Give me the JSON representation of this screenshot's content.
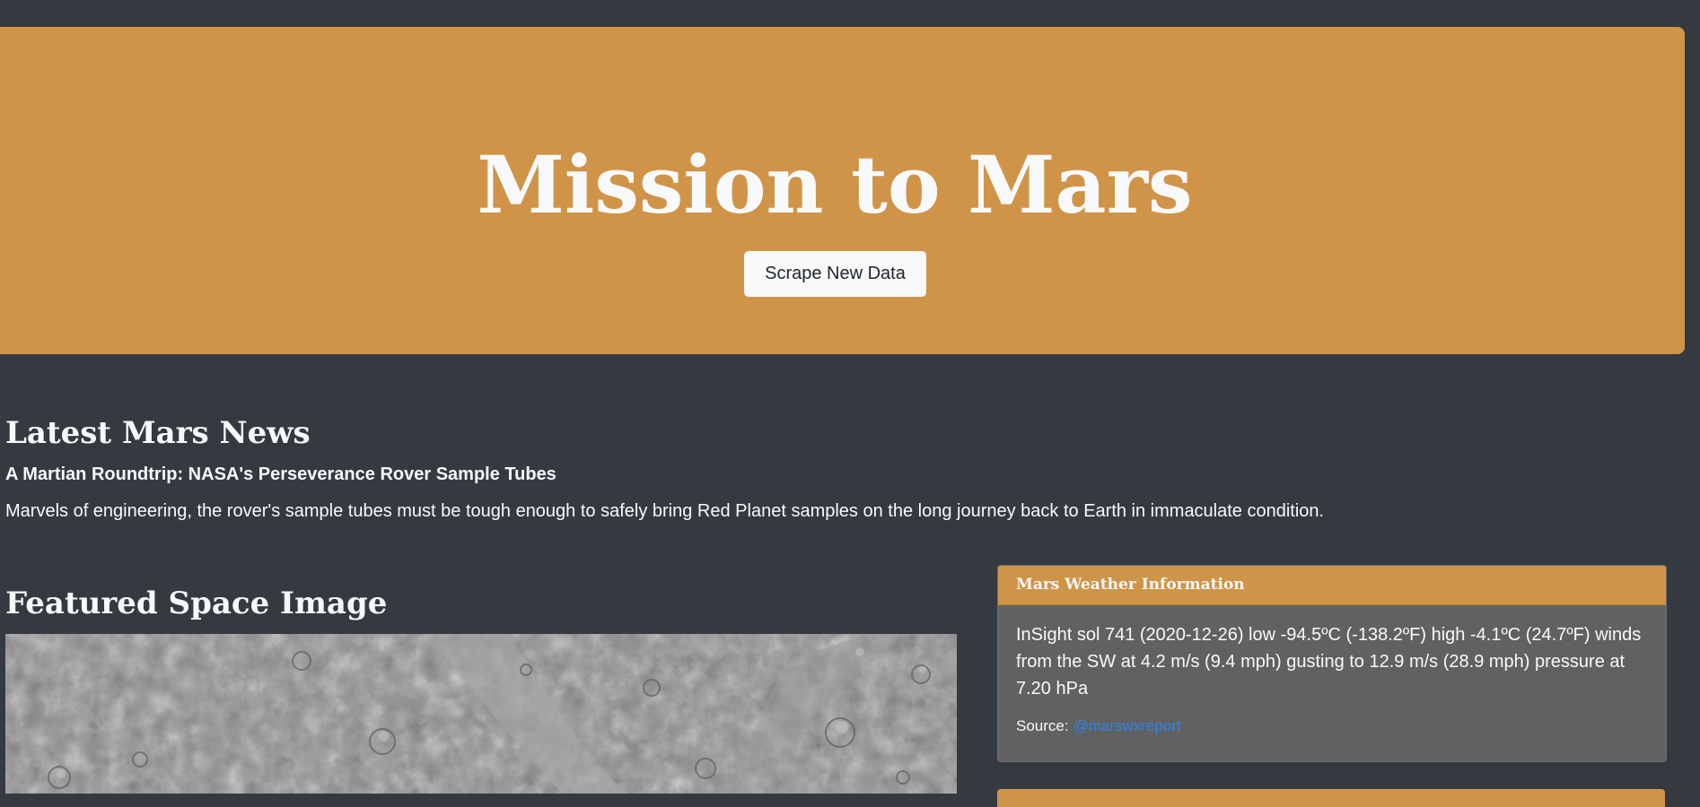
{
  "jumbotron": {
    "title": "Mission to Mars",
    "button_label": "Scrape New Data",
    "background_color": "#d09448"
  },
  "news": {
    "heading": "Latest Mars News",
    "title": "A Martian Roundtrip: NASA's Perseverance Rover Sample Tubes",
    "paragraph": "Marvels of engineering, the rover's sample tubes must be tough enough to safely bring Red Planet samples on the long journey back to Earth in immaculate condition."
  },
  "featured": {
    "heading": "Featured Space Image"
  },
  "weather": {
    "header": "Mars Weather Information",
    "text": "InSight sol 741 (2020-12-26) low -94.5ºC (-138.2ºF) high -4.1ºC (24.7ºF) winds from the SW at 4.2 m/s (9.4 mph) gusting to 12.9 m/s (28.9 mph) pressure at 7.20 hPa",
    "source_label": "Source:",
    "source_link": "@marswxreport"
  },
  "colors": {
    "page_background": "#343a40",
    "accent": "#d09448",
    "card_background": "#616161",
    "link": "#2e84e6"
  }
}
